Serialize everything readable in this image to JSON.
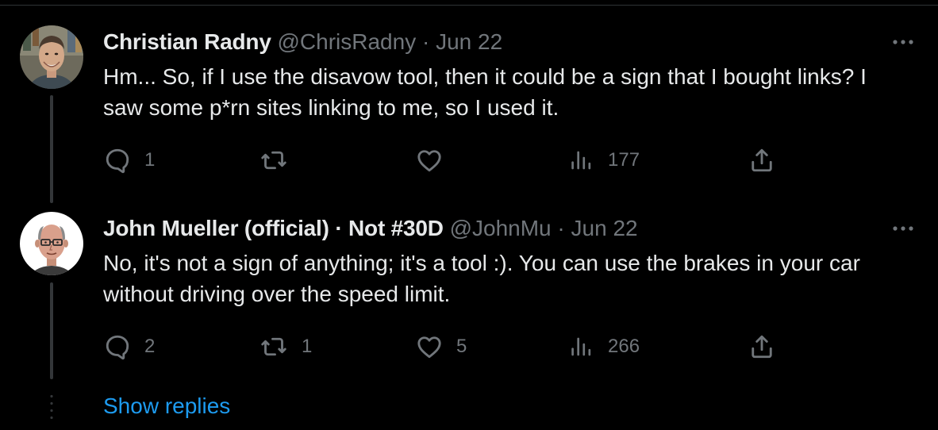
{
  "tweets": [
    {
      "display_name": "Christian Radny",
      "handle": "@ChrisRadny",
      "separator": "·",
      "date": "Jun 22",
      "text": "Hm... So, if I use the disavow tool, then it could be a sign that I bought links? I saw some p*rn sites linking to me, so I used it.",
      "actions": {
        "reply_count": "1",
        "retweet_count": "",
        "like_count": "",
        "view_count": "177"
      },
      "more_icon": "more-horizontal-icon"
    },
    {
      "display_name": "John Mueller (official) · Not #30D",
      "handle": "@JohnMu",
      "separator": "·",
      "date": "Jun 22",
      "text": "No, it's not a sign of anything; it's a tool :). You can use the brakes in your car without driving over the speed limit.",
      "actions": {
        "reply_count": "2",
        "retweet_count": "1",
        "like_count": "5",
        "view_count": "266"
      },
      "more_icon": "more-horizontal-icon"
    }
  ],
  "show_replies_label": "Show replies",
  "icons": {
    "reply": "reply-icon",
    "retweet": "retweet-icon",
    "like": "heart-icon",
    "views": "views-icon",
    "share": "share-icon"
  },
  "colors": {
    "background": "#000000",
    "primary_text": "#e7e9ea",
    "secondary_text": "#71767b",
    "link": "#1d9bf0",
    "thread_line": "#333639"
  }
}
